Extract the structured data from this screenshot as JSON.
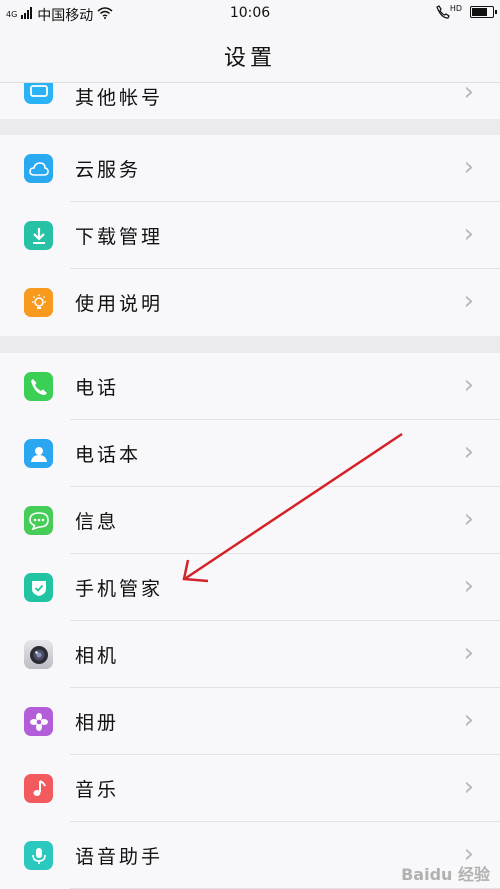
{
  "status_bar": {
    "network_badge": "4G",
    "carrier": "中国移动",
    "time": "10:06",
    "hd_label": "HD",
    "battery_percent": 80
  },
  "header": {
    "title": "设置"
  },
  "sections": [
    {
      "items": [
        {
          "label": "其他帐号",
          "icon": "account-icon",
          "color": "#29b3f5"
        }
      ]
    },
    {
      "items": [
        {
          "label": "云服务",
          "icon": "cloud-icon",
          "color": "#29a9ef"
        },
        {
          "label": "下载管理",
          "icon": "download-icon",
          "color": "#27c1a5"
        },
        {
          "label": "使用说明",
          "icon": "lightbulb-icon",
          "color": "#f79a1e"
        }
      ]
    },
    {
      "items": [
        {
          "label": "电话",
          "icon": "phone-icon",
          "color": "#3ccf55"
        },
        {
          "label": "电话本",
          "icon": "contacts-icon",
          "color": "#2ba6f0"
        },
        {
          "label": "信息",
          "icon": "message-icon",
          "color": "#45cd57"
        },
        {
          "label": "手机管家",
          "icon": "shield-icon",
          "color": "#20c3a2"
        },
        {
          "label": "相机",
          "icon": "camera-icon",
          "color": "#6a6a72"
        },
        {
          "label": "相册",
          "icon": "flower-icon",
          "color": "#b25ed8"
        },
        {
          "label": "音乐",
          "icon": "music-note-icon",
          "color": "#f25a5e"
        },
        {
          "label": "语音助手",
          "icon": "microphone-icon",
          "color": "#2bc8c0"
        }
      ]
    }
  ],
  "annotation": {
    "color": "#d3222a"
  },
  "watermark": "Baidu 经验"
}
